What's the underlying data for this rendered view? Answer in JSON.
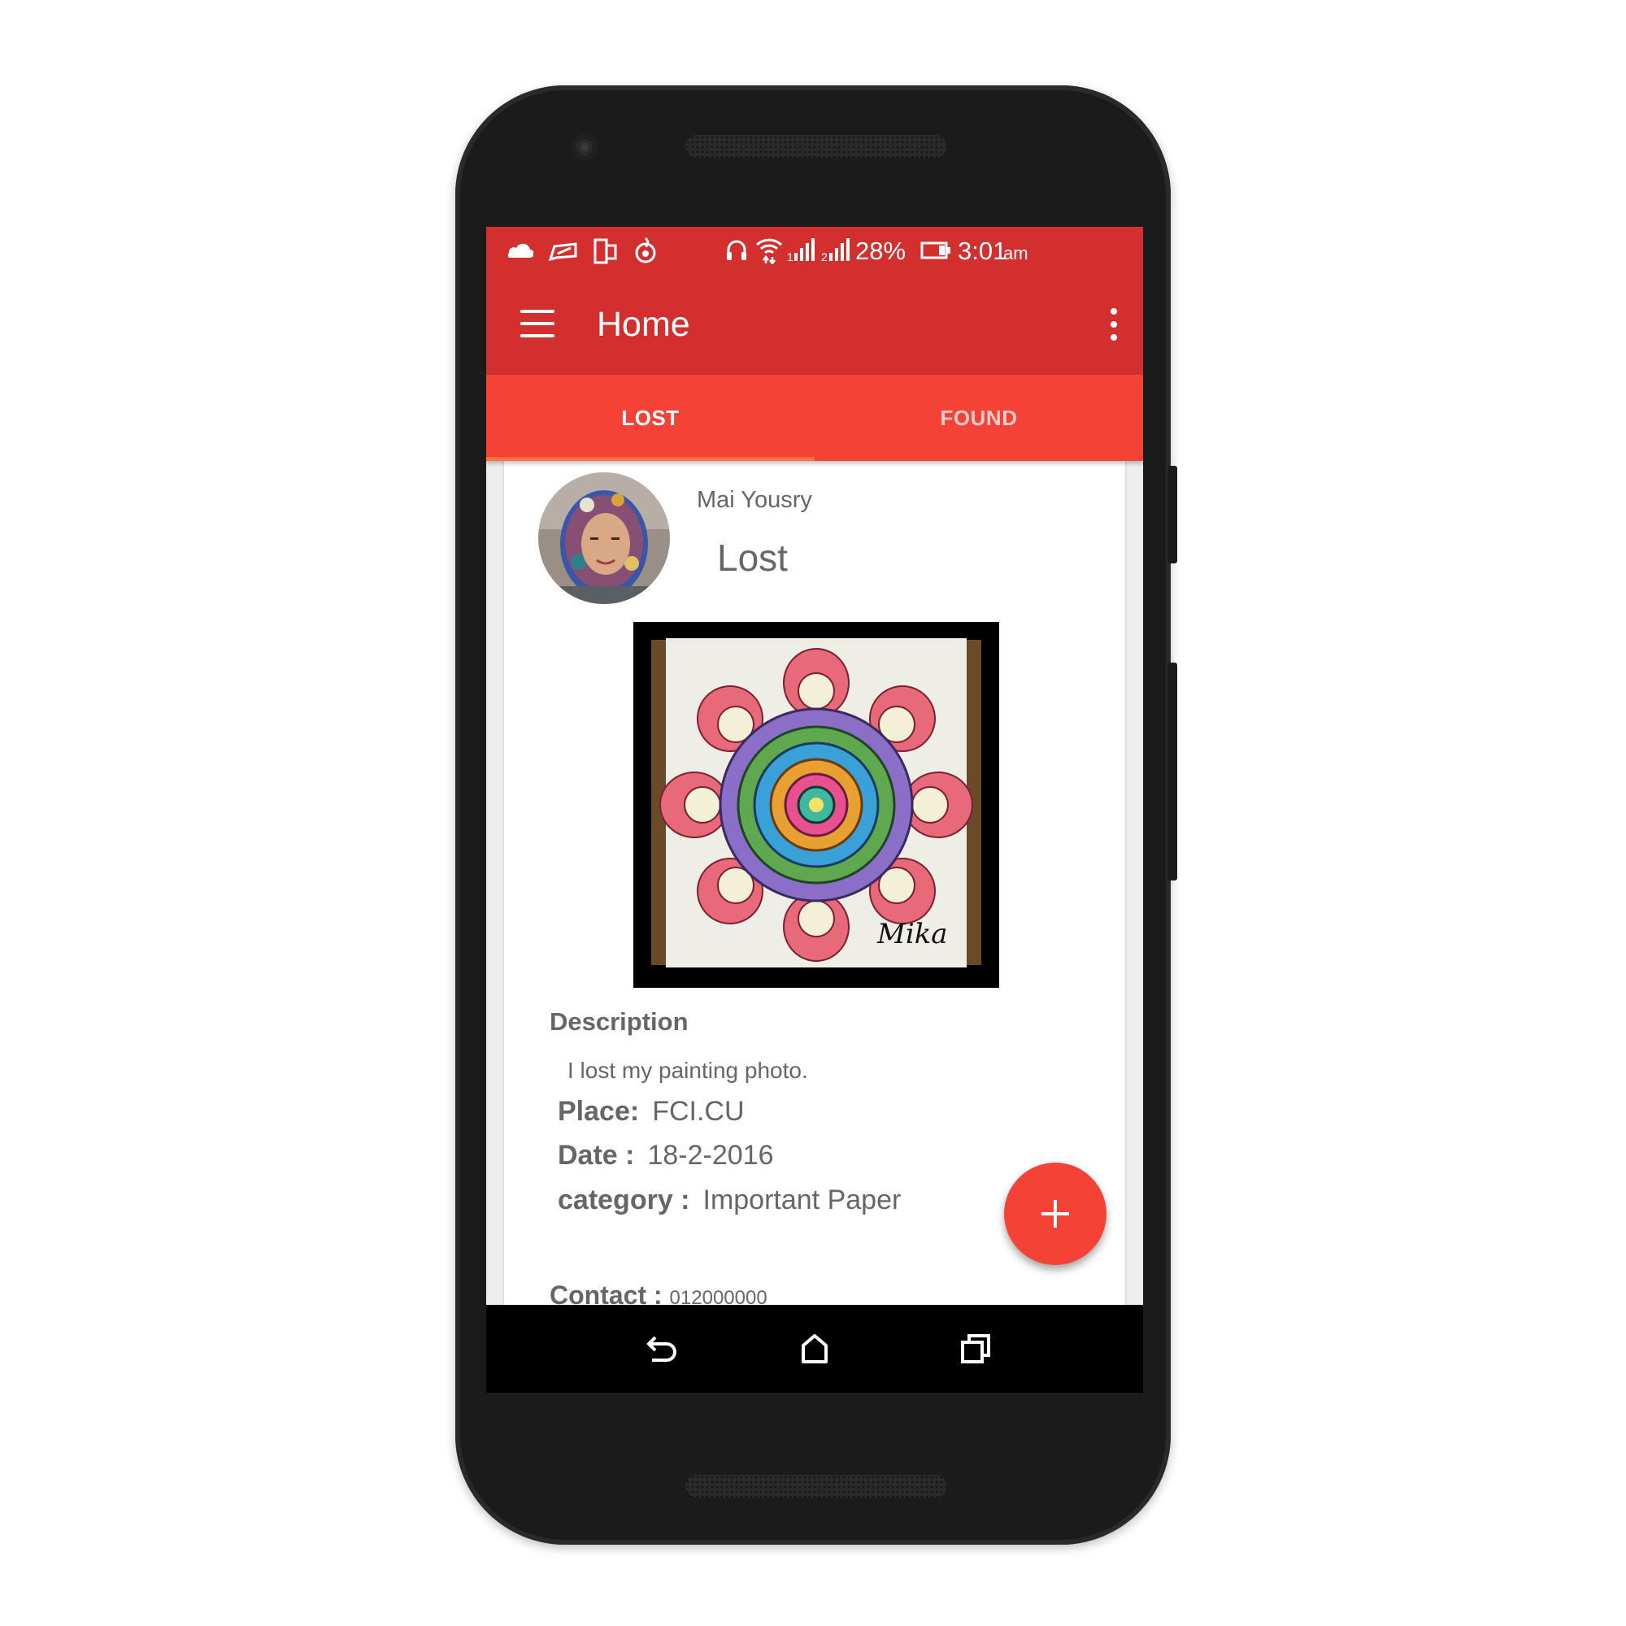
{
  "status_bar": {
    "battery": "28%",
    "time": "3:01",
    "ampm": "am",
    "icons_left": [
      "cloud-icon",
      "message-icon",
      "screen-mirror-icon",
      "flame-icon"
    ],
    "icons_right": [
      "headset-icon",
      "wifi-icon",
      "signal-1-icon",
      "signal-2-icon",
      "battery-icon"
    ]
  },
  "app_bar": {
    "title": "Home",
    "menu_icon": "hamburger-menu-icon",
    "overflow_icon": "more-vert-icon"
  },
  "tabs": [
    {
      "label": "LOST",
      "active": true
    },
    {
      "label": "FOUND",
      "active": false
    }
  ],
  "post": {
    "user_name": "Mai Yousry",
    "status": "Lost",
    "description_title": "Description",
    "description": "I lost my painting photo.",
    "photo_signature": "Mika",
    "place_label": "Place:",
    "place_value": "FCI.CU",
    "date_label": "Date :",
    "date_value": "18-2-2016",
    "category_label": "category :",
    "category_value": "Important Paper",
    "contact_label": "Contact :",
    "contact_value": "012000000"
  },
  "fab": {
    "icon": "add-icon"
  },
  "nav_bar": {
    "buttons": [
      "back-icon",
      "home-icon",
      "recents-icon"
    ]
  },
  "colors": {
    "primary_dark": "#d32f2f",
    "tab_bar": "#f44336",
    "accent": "#ff7043",
    "fab": "#f44336"
  }
}
